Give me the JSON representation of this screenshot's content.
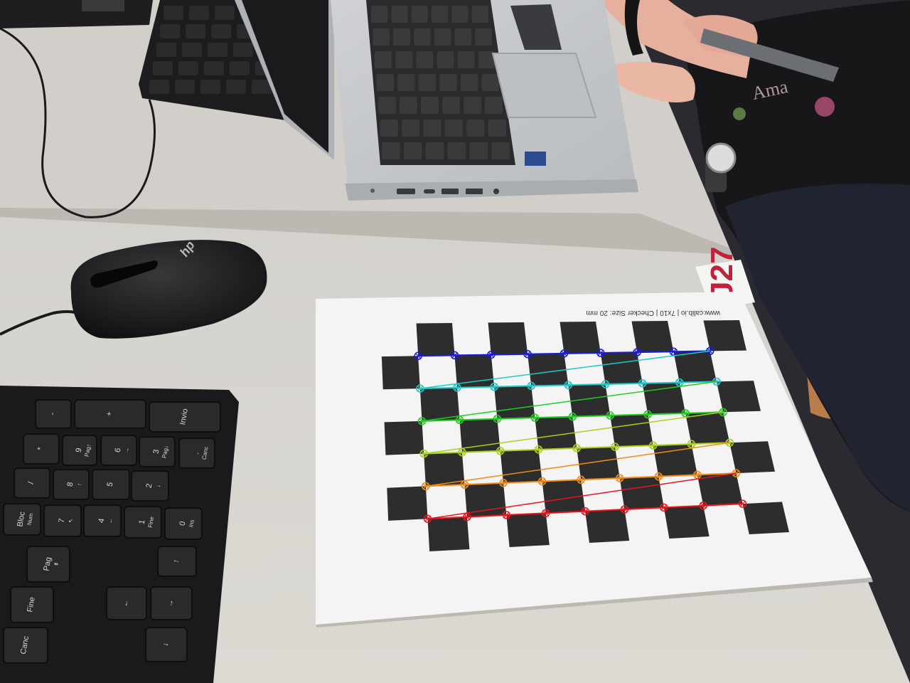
{
  "scene": {
    "description_type": "photo",
    "colors": {
      "desk": "#d7d4cf",
      "desk_shadow": "#c4c0ba",
      "desk_edge": "#b9b5ae",
      "paper": "#f4f4f4",
      "square": "#2d2d2d",
      "keyboard": "#1c1c1e",
      "key": "#2a2a2c",
      "key_text": "#d8d8d8",
      "laptop": "#c8cacd",
      "laptop_dark": "#9fa2a6",
      "mouse": "#18181a",
      "clothing": "#1a1a1c",
      "skin": "#e9b7a6",
      "sticker_text": "#c0223b"
    }
  },
  "paper": {
    "header_text": "www.calib.io | 7x10 | Checker Size: 20 mm"
  },
  "desk_label": {
    "text": "J27"
  },
  "mouse": {
    "logo": "hp"
  },
  "calibration_overlay": {
    "rows": 6,
    "cols": 9,
    "row_colors": [
      "#1a1adc",
      "#1fc8c8",
      "#22cc22",
      "#a8d21a",
      "#f08a18",
      "#e8141e"
    ]
  },
  "keyboard": {
    "keys": [
      {
        "id": "minus",
        "label": "-"
      },
      {
        "id": "plus",
        "label": "+"
      },
      {
        "id": "invio",
        "label": "Invio"
      },
      {
        "id": "star",
        "label": "*"
      },
      {
        "id": "k9",
        "label": "9",
        "sub": "Pag↑"
      },
      {
        "id": "k6",
        "label": "6",
        "sub": "→"
      },
      {
        "id": "k3",
        "label": "3",
        "sub": "Pag↓"
      },
      {
        "id": "dot",
        "label": ".",
        "sub": "Canc"
      },
      {
        "id": "slash",
        "label": "/"
      },
      {
        "id": "k8",
        "label": "8",
        "sub": "↑"
      },
      {
        "id": "k5",
        "label": "5"
      },
      {
        "id": "k2",
        "label": "2",
        "sub": "↓"
      },
      {
        "id": "bloc",
        "label": "Bloc",
        "sub": "Num"
      },
      {
        "id": "k7",
        "label": "7",
        "sub": "↖"
      },
      {
        "id": "k4",
        "label": "4",
        "sub": "←"
      },
      {
        "id": "k1",
        "label": "1",
        "sub": "Fine"
      },
      {
        "id": "k0",
        "label": "0",
        "sub": "Ins"
      },
      {
        "id": "pag",
        "label": "Pag",
        "sub": "⇞"
      },
      {
        "id": "fine",
        "label": "Fine"
      },
      {
        "id": "canc",
        "label": "Canc"
      },
      {
        "id": "arrow_up",
        "label": "↑"
      },
      {
        "id": "arrow_left",
        "label": "←"
      },
      {
        "id": "arrow_down",
        "label": "↓"
      },
      {
        "id": "arrow_right",
        "label": "→"
      }
    ]
  }
}
